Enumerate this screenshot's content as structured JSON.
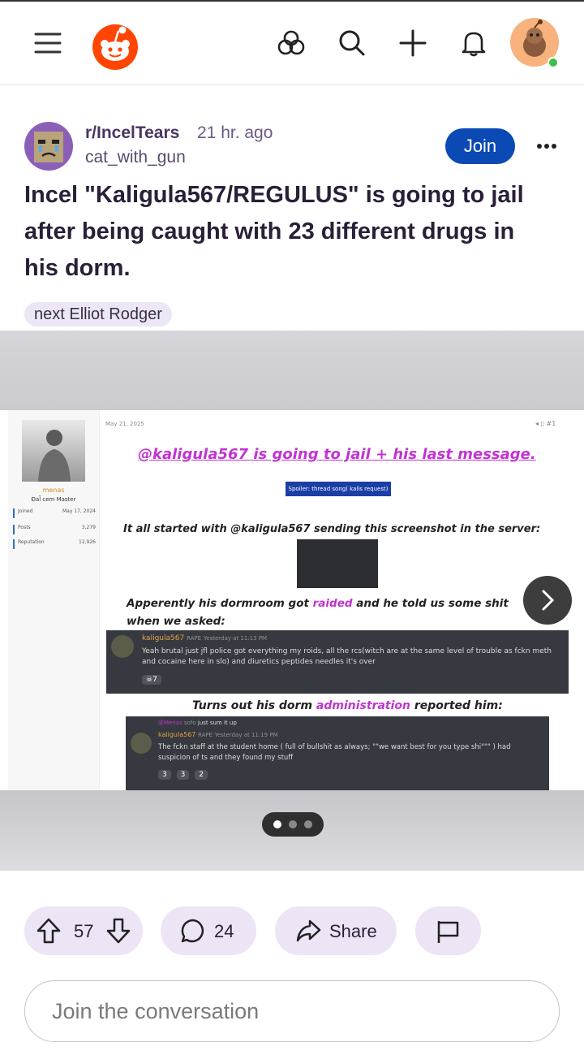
{
  "header": {
    "menu_icon": "hamburger-menu-icon",
    "logo_icon": "reddit-logo-icon",
    "actions": [
      "explore-icon",
      "search-icon",
      "plus-icon",
      "bell-icon"
    ],
    "avatar_status": "online",
    "brand_color": "#ff4500"
  },
  "post": {
    "subreddit": "r/IncelTears",
    "time_ago": "21 hr. ago",
    "author": "cat_with_gun",
    "join_label": "Join",
    "more_icon": "more-dots-icon",
    "title": "Incel \"Kaligula567/REGULUS\" is going to jail after being caught with 23 different drugs in his dorm.",
    "flair": "next Elliot Rodger"
  },
  "gallery": {
    "image_count": 3,
    "current_index": 1,
    "screenshot": {
      "profile_name": "menas",
      "profile_role": "Ɖal̄ cem Master",
      "stats": [
        {
          "label": "Joined",
          "value": "May 17, 2024"
        },
        {
          "label": "Posts",
          "value": "3,279"
        },
        {
          "label": "Reputation",
          "value": "12,926"
        }
      ],
      "date": "May 21, 2025",
      "post_number": "#1",
      "heading": "@kaligula567 is going to jail + his last message.",
      "spoiler": "Spoiler: thread song( kalis request)",
      "line1": "It all started with @kaligula567 sending this screenshot in the server:",
      "line2_a": "Apperently his dormroom got ",
      "line2_hl": "raided",
      "line2_b": " and he told us some shit when we asked:",
      "msg1": {
        "name": "kaligula567",
        "badge": "RAPE",
        "time": "Yesterday at 11:13 PM",
        "text": "Yeah brutal just jfl police got everything my roids, all the rcs(witch are at the same level of trouble as fckn meth and cocaine here in slo) and diuretics peptides needles it's over",
        "reaction_count": "7"
      },
      "line3_a": "Turns out his dorm ",
      "line3_hl": "administration",
      "line3_b": " reported him:",
      "msg2": {
        "reply_to": "@Menas",
        "reply_text": "just sum it up",
        "reply_badge": "sofo",
        "name": "kaligula567",
        "badge": "RAPE",
        "time": "Yesterday at 11:19 PM",
        "text": "The fckn staff at the student home ( full of bullshit as always; \"\"we want best for you type shi\"\"\" ) had suspicion of ts and they found my stuff",
        "reactions": [
          "3",
          "3",
          "2"
        ]
      }
    }
  },
  "actions": {
    "upvotes": "57",
    "comments": "24",
    "share_label": "Share",
    "award_icon": "flag-icon"
  },
  "comment_box": {
    "placeholder": "Join the conversation"
  }
}
